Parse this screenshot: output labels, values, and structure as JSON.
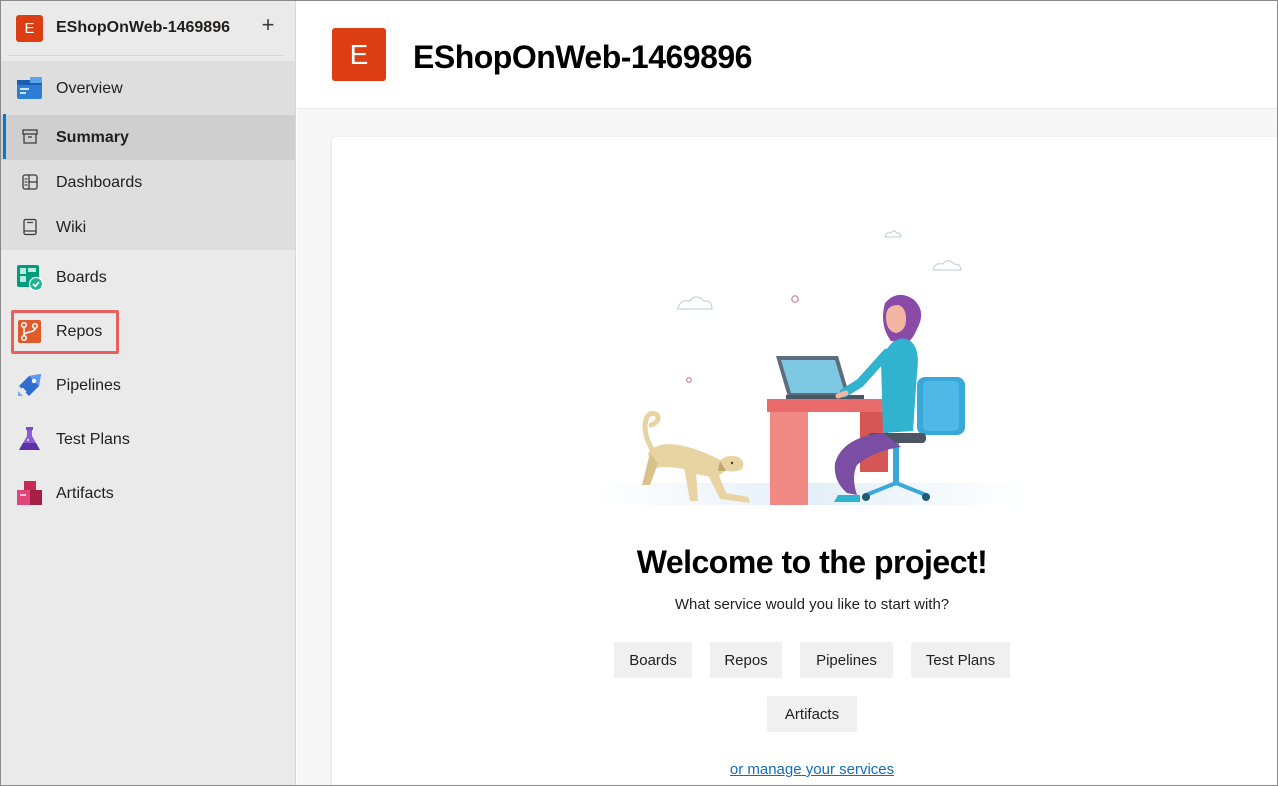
{
  "project": {
    "initial": "E",
    "name": "EShopOnWeb-1469896",
    "add_symbol": "+"
  },
  "sidebar": {
    "overview": {
      "label": "Overview",
      "icon": "overview-icon"
    },
    "sub_items": [
      {
        "label": "Summary",
        "icon": "summary-icon",
        "selected": true
      },
      {
        "label": "Dashboards",
        "icon": "dashboards-icon"
      },
      {
        "label": "Wiki",
        "icon": "wiki-icon"
      }
    ],
    "items": [
      {
        "label": "Boards",
        "icon": "boards-icon"
      },
      {
        "label": "Repos",
        "icon": "repos-icon",
        "highlighted": true
      },
      {
        "label": "Pipelines",
        "icon": "pipelines-icon"
      },
      {
        "label": "Test Plans",
        "icon": "test-plans-icon"
      },
      {
        "label": "Artifacts",
        "icon": "artifacts-icon"
      }
    ]
  },
  "header": {
    "initial": "E",
    "title": "EShopOnWeb-1469896"
  },
  "welcome": {
    "title": "Welcome to the project!",
    "question": "What service would you like to start with?",
    "services": [
      "Boards",
      "Repos",
      "Pipelines",
      "Test Plans",
      "Artifacts"
    ],
    "manage_link": "or manage your services"
  },
  "colors": {
    "accent": "#0078d4",
    "project_badge": "#dc3d12",
    "highlight_box": "#e85f5f",
    "link": "#106ebe"
  }
}
